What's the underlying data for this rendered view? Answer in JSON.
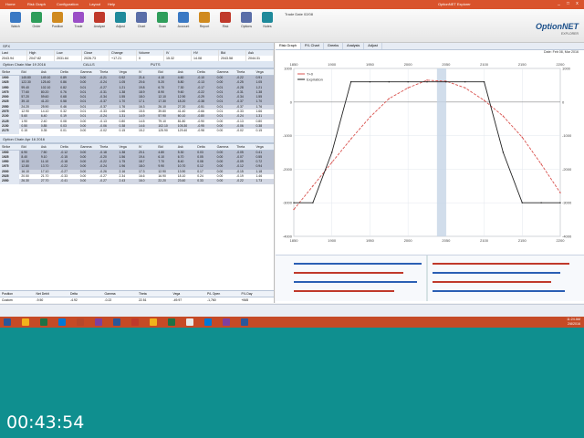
{
  "titlebar": {
    "tabs": [
      "Home",
      "Risk Graph",
      "Configuration",
      "Layout",
      "Help"
    ],
    "active_tab": "Home",
    "right_status": "OptionNET Explorer",
    "window_controls": [
      "_",
      "□",
      "x"
    ]
  },
  "ribbon": {
    "items": [
      "Watch",
      "Order",
      "Position",
      "Trade",
      "Analyze",
      "Adjust",
      "Chart",
      "Scan",
      "Account",
      "Report",
      "Risk",
      "Options",
      "Notes"
    ],
    "date_label": "Trade Date 02/08",
    "logo": "OptionNET",
    "logo_sub": "EXPLORER"
  },
  "quote": {
    "symbol": "SPX",
    "headers": [
      "Last",
      "High",
      "Low",
      "Close",
      "Change",
      "Volume",
      "IV",
      "HV",
      "Bid",
      "Ask"
    ],
    "values": [
      "2043.94",
      "2047.82",
      "2031.64",
      "2026.73",
      "+17.21",
      "0",
      "15.32",
      "14.08",
      "2043.58",
      "2044.31"
    ]
  },
  "chain": {
    "expiry_label": "Option Chain  Mar 19 2016",
    "call_label": "CALLS",
    "put_label": "PUTS",
    "headers": [
      "Strike",
      "Bid",
      "Ask",
      "Delta",
      "Gamma",
      "Theta",
      "Vega",
      "IV",
      "Bid",
      "Ask",
      "Delta",
      "Gamma",
      "Theta",
      "Vega"
    ],
    "rows": [
      [
        "1900",
        "145.80",
        "149.10",
        "0.89",
        "0.00",
        "-0.21",
        "0.92",
        "21.4",
        "4.10",
        "4.60",
        "-0.10",
        "0.00",
        "-0.22",
        "0.91"
      ],
      [
        "1925",
        "122.30",
        "125.40",
        "0.86",
        "0.00",
        "-0.24",
        "1.05",
        "20.6",
        "5.20",
        "5.80",
        "-0.13",
        "0.00",
        "-0.25",
        "1.05"
      ],
      [
        "1950",
        "99.40",
        "102.10",
        "0.82",
        "0.01",
        "-0.27",
        "1.21",
        "19.8",
        "6.70",
        "7.30",
        "-0.17",
        "0.01",
        "-0.28",
        "1.21"
      ],
      [
        "1975",
        "77.60",
        "80.20",
        "0.76",
        "0.01",
        "-0.31",
        "1.38",
        "18.9",
        "8.90",
        "9.60",
        "-0.22",
        "0.01",
        "-0.31",
        "1.38"
      ],
      [
        "2000",
        "57.20",
        "59.60",
        "0.68",
        "0.01",
        "-0.34",
        "1.55",
        "18.0",
        "12.10",
        "12.90",
        "-0.29",
        "0.01",
        "-0.34",
        "1.55"
      ],
      [
        "2025",
        "39.10",
        "41.20",
        "0.58",
        "0.01",
        "-0.37",
        "1.70",
        "17.1",
        "17.30",
        "18.20",
        "-0.38",
        "0.01",
        "-0.37",
        "1.70"
      ],
      [
        "2050",
        "24.20",
        "25.90",
        "0.46",
        "0.01",
        "-0.37",
        "1.76",
        "16.3",
        "26.10",
        "27.20",
        "-0.51",
        "0.01",
        "-0.37",
        "1.76"
      ],
      [
        "2075",
        "12.90",
        "14.10",
        "0.32",
        "0.01",
        "-0.33",
        "1.66",
        "15.5",
        "39.80",
        "41.40",
        "-0.66",
        "0.01",
        "-0.33",
        "1.66"
      ],
      [
        "2100",
        "5.60",
        "6.40",
        "0.19",
        "0.01",
        "-0.24",
        "1.31",
        "14.9",
        "57.90",
        "60.10",
        "-0.80",
        "0.01",
        "-0.24",
        "1.31"
      ],
      [
        "2125",
        "1.90",
        "2.40",
        "0.08",
        "0.00",
        "-0.13",
        "0.80",
        "14.5",
        "79.10",
        "81.80",
        "-0.90",
        "0.00",
        "-0.13",
        "0.80"
      ],
      [
        "2150",
        "0.50",
        "0.85",
        "0.03",
        "0.00",
        "-0.06",
        "0.38",
        "14.6",
        "102.10",
        "105.30",
        "-0.95",
        "0.00",
        "-0.06",
        "0.38"
      ],
      [
        "2175",
        "0.15",
        "0.35",
        "0.01",
        "0.00",
        "-0.02",
        "0.15",
        "15.2",
        "125.90",
        "129.40",
        "-0.98",
        "0.00",
        "-0.02",
        "0.15"
      ]
    ]
  },
  "puts_chain": {
    "expiry_label": "Option Chain  Apr 16 2016",
    "rows": [
      [
        "1900",
        "6.90",
        "7.50",
        "-0.12",
        "0.00",
        "-0.18",
        "1.38",
        "20.1",
        "4.80",
        "5.30",
        "0.03",
        "0.00",
        "-0.05",
        "0.41"
      ],
      [
        "1925",
        "8.40",
        "9.10",
        "-0.15",
        "0.00",
        "-0.20",
        "1.56",
        "19.4",
        "6.10",
        "6.70",
        "0.05",
        "0.00",
        "-0.07",
        "0.55"
      ],
      [
        "1950",
        "10.30",
        "11.10",
        "-0.18",
        "0.00",
        "-0.22",
        "1.75",
        "18.7",
        "7.70",
        "8.40",
        "0.08",
        "0.00",
        "-0.09",
        "0.72"
      ],
      [
        "1975",
        "12.80",
        "13.70",
        "-0.22",
        "0.00",
        "-0.24",
        "1.96",
        "18.0",
        "9.90",
        "10.70",
        "0.12",
        "0.00",
        "-0.12",
        "0.94"
      ],
      [
        "2000",
        "16.10",
        "17.10",
        "-0.27",
        "0.00",
        "-0.26",
        "2.16",
        "17.3",
        "12.90",
        "13.90",
        "0.17",
        "0.00",
        "-0.15",
        "1.18"
      ],
      [
        "2025",
        "20.50",
        "21.70",
        "-0.33",
        "0.00",
        "-0.27",
        "2.34",
        "16.6",
        "16.90",
        "18.10",
        "0.24",
        "0.00",
        "-0.19",
        "1.46"
      ],
      [
        "2050",
        "26.30",
        "27.70",
        "-0.41",
        "0.00",
        "-0.27",
        "2.43",
        "16.0",
        "22.20",
        "23.60",
        "0.33",
        "0.00",
        "-0.22",
        "1.73"
      ]
    ]
  },
  "chain_footer": {
    "labels": [
      "Position",
      "Net Debit",
      "Delta",
      "Gamma",
      "Theta",
      "Vega",
      "P/L Open",
      "P/L Day"
    ],
    "values": [
      "Custom",
      "-9.50",
      "-4.92",
      "-0.22",
      "22.51",
      "-49.97",
      "-1,760",
      "+845"
    ]
  },
  "risk_graph": {
    "tabs": [
      "Risk Graph",
      "P/L Chart",
      "Greeks",
      "Analysis",
      "Adjust"
    ],
    "active_tab": "Risk Graph",
    "toolbar_right": "Date: Feb 08, Mar 2016"
  },
  "chart_data": {
    "type": "line",
    "xlabel": "",
    "ylabel": "",
    "x": [
      1850,
      1875,
      1900,
      1925,
      1950,
      1975,
      2000,
      2025,
      2050,
      2075,
      2100,
      2125,
      2150,
      2175,
      2200
    ],
    "xlim": [
      1850,
      2200
    ],
    "ylim": [
      -4000,
      1000
    ],
    "series": [
      {
        "name": "T+0",
        "values": [
          -3200,
          -2500,
          -1800,
          -1100,
          -450,
          100,
          420,
          650,
          620,
          420,
          50,
          -420,
          -1050,
          -1850,
          -2700
        ]
      },
      {
        "name": "Expiration",
        "values": [
          -3000,
          -3000,
          -1500,
          600,
          600,
          600,
          600,
          600,
          600,
          600,
          600,
          -1500,
          -3000,
          -3000,
          -3000
        ]
      }
    ],
    "tick_labels_x": [
      "1850",
      "1900",
      "1950",
      "2000",
      "2050",
      "2100",
      "2150",
      "2200"
    ],
    "tick_labels_y": [
      "1000",
      "0",
      "-1000",
      "-2000",
      "-3000",
      "-4000"
    ],
    "price_marker": 2044
  },
  "taskbar": {
    "time": "11:24 AM",
    "date": "2/8/2016"
  },
  "video_timer": "00:43:54"
}
